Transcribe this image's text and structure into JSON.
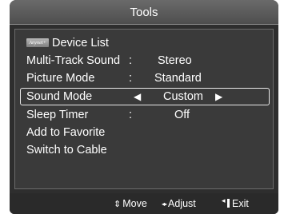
{
  "window": {
    "title": "Tools"
  },
  "menu": {
    "device_list": {
      "logo_text": "Anynet+",
      "label": "Device List"
    },
    "items": [
      {
        "label": "Multi-Track Sound",
        "separator": ":",
        "value": "Stereo"
      },
      {
        "label": "Picture Mode",
        "separator": ":",
        "value": "Standard"
      },
      {
        "label": "Sound Mode",
        "left_arrow": "◀",
        "value": "Custom",
        "right_arrow": "▶"
      },
      {
        "label": "Sleep Timer",
        "separator": ":",
        "value": "Off"
      },
      {
        "label": "Add to Favorite"
      },
      {
        "label": "Switch to Cable"
      }
    ],
    "selected_index": 2
  },
  "footer": {
    "move": {
      "icon": "up-down-arrows-icon",
      "glyph": "⇕",
      "label": "Move"
    },
    "adjust": {
      "icon": "left-right-arrows-icon",
      "glyph": "◂▸",
      "label": "Adjust"
    },
    "exit": {
      "icon": "exit-icon",
      "label": "Exit"
    }
  },
  "colors": {
    "panel_background": "#2e2e2e",
    "title_bar": "#5c5c5c",
    "text": "#ffffff",
    "selection_border": "#e8e8e8"
  }
}
